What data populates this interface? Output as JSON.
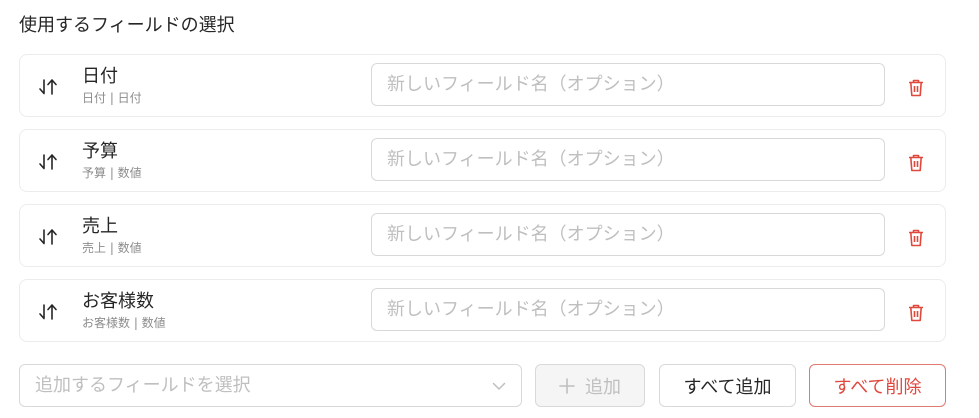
{
  "section": {
    "title": "使用するフィールドの選択"
  },
  "fields": [
    {
      "name": "日付",
      "sub": "日付 | 日付",
      "rename_placeholder": "新しいフィールド名（オプション）",
      "rename_value": ""
    },
    {
      "name": "予算",
      "sub": "予算 | 数値",
      "rename_placeholder": "新しいフィールド名（オプション）",
      "rename_value": ""
    },
    {
      "name": "売上",
      "sub": "売上 | 数値",
      "rename_placeholder": "新しいフィールド名（オプション）",
      "rename_value": ""
    },
    {
      "name": "お客様数",
      "sub": "お客様数 | 数値",
      "rename_placeholder": "新しいフィールド名（オプション）",
      "rename_value": ""
    }
  ],
  "footer": {
    "select_placeholder": "追加するフィールドを選択",
    "add_label": "追加",
    "add_all_label": "すべて追加",
    "delete_all_label": "すべて削除"
  },
  "icons": {
    "drag": "drag-sort-icon",
    "delete": "trash-icon",
    "dropdown": "chevron-down-icon",
    "add": "plus-icon"
  },
  "colors": {
    "danger": "#e0483d",
    "danger_border": "#e0796f",
    "border": "#d9d9d9",
    "placeholder": "#bfbfbf",
    "disabled_bg": "#f5f5f5"
  }
}
